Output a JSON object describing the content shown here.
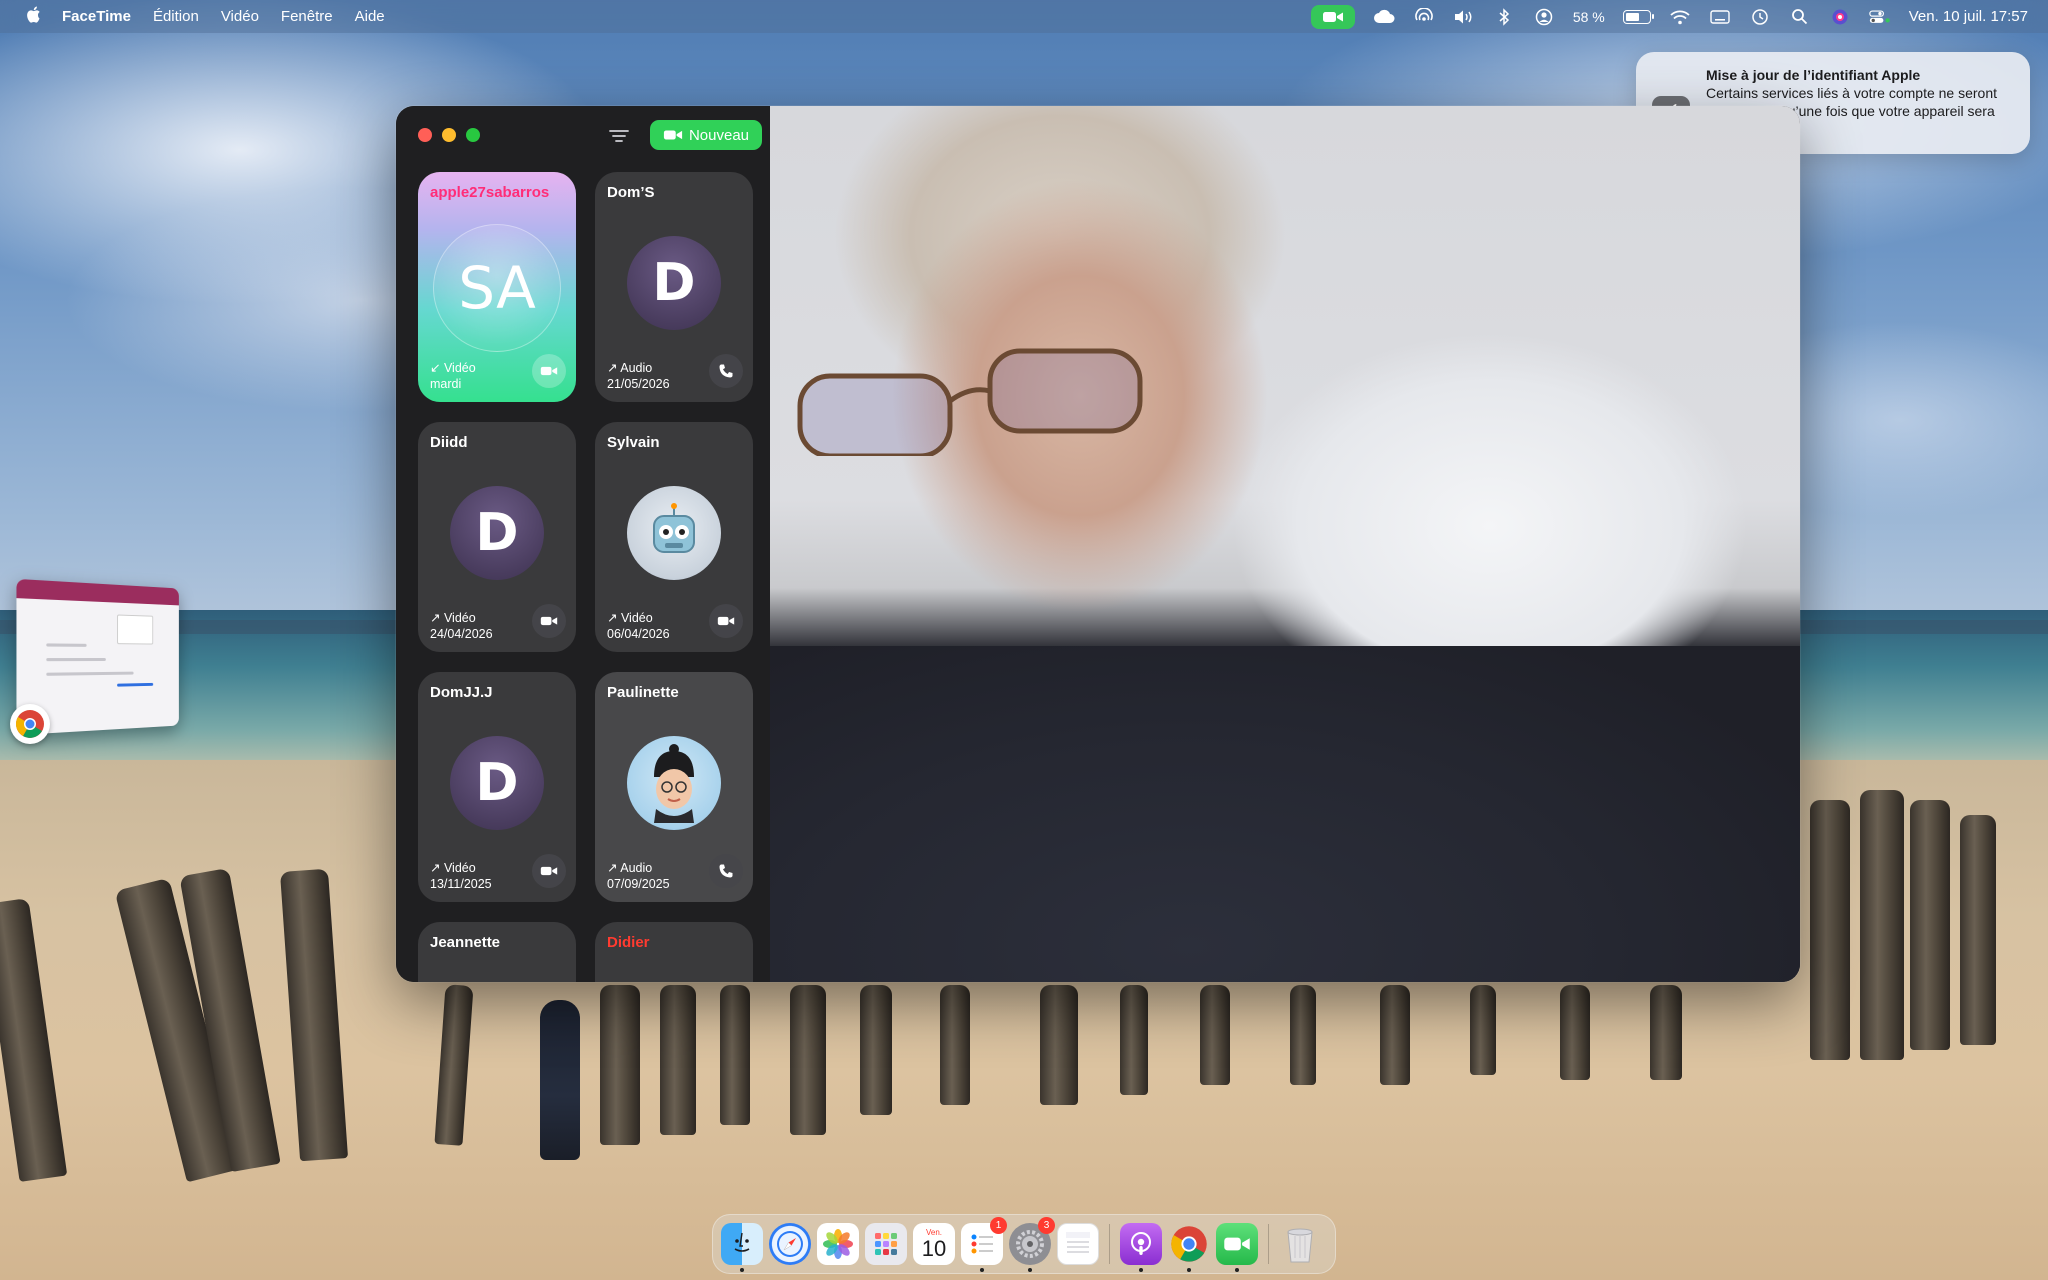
{
  "menubar": {
    "app_name": "FaceTime",
    "menus": [
      "Édition",
      "Vidéo",
      "Fenêtre",
      "Aide"
    ],
    "battery_percent": "58 %",
    "battery_level": 0.58,
    "datetime": "Ven. 10 juil.  17:57"
  },
  "notification": {
    "title": "Mise à jour de l’identifiant Apple",
    "body": "Certains services liés à votre compte ne seront disponibles qu’une fois que votre appareil sera reconnecté."
  },
  "facetime": {
    "new_button_label": "Nouveau",
    "contacts": [
      {
        "name": "apple27sabarros",
        "initials": "SA",
        "call_type": "↙ Vidéo",
        "date": "mardi",
        "action_icon": "video-icon"
      },
      {
        "name": "Dom’S",
        "initials": "D",
        "call_type": "↗ Audio",
        "date": "21/05/2026",
        "action_icon": "phone-icon"
      },
      {
        "name": "Diidd",
        "initials": "D",
        "call_type": "↗ Vidéo",
        "date": "24/04/2026",
        "action_icon": "video-icon"
      },
      {
        "name": "Sylvain",
        "initials": "",
        "call_type": "↗ Vidéo",
        "date": "06/04/2026",
        "action_icon": "video-icon"
      },
      {
        "name": "DomJJ.J",
        "initials": "D",
        "call_type": "↗ Vidéo",
        "date": "13/11/2025",
        "action_icon": "video-icon"
      },
      {
        "name": "Paulinette",
        "initials": "",
        "call_type": "↗ Audio",
        "date": "07/09/2025",
        "action_icon": "phone-icon"
      },
      {
        "name": "Jeannette",
        "initials": "",
        "call_type": "",
        "date": "",
        "action_icon": ""
      },
      {
        "name": "Didier",
        "initials": "",
        "call_type": "",
        "date": "",
        "action_icon": ""
      }
    ]
  },
  "dock": {
    "items": [
      "finder-icon",
      "safari-icon",
      "photos-icon",
      "launchpad-icon",
      "calendar-icon",
      "reminders-icon",
      "system-settings-icon",
      "notes-icon",
      "podcasts-icon",
      "chrome-icon",
      "facetime-icon",
      "trash-icon"
    ],
    "calendar_month": "Ven.",
    "calendar_day": "10",
    "reminders_badge": "1",
    "settings_badge": "3"
  }
}
